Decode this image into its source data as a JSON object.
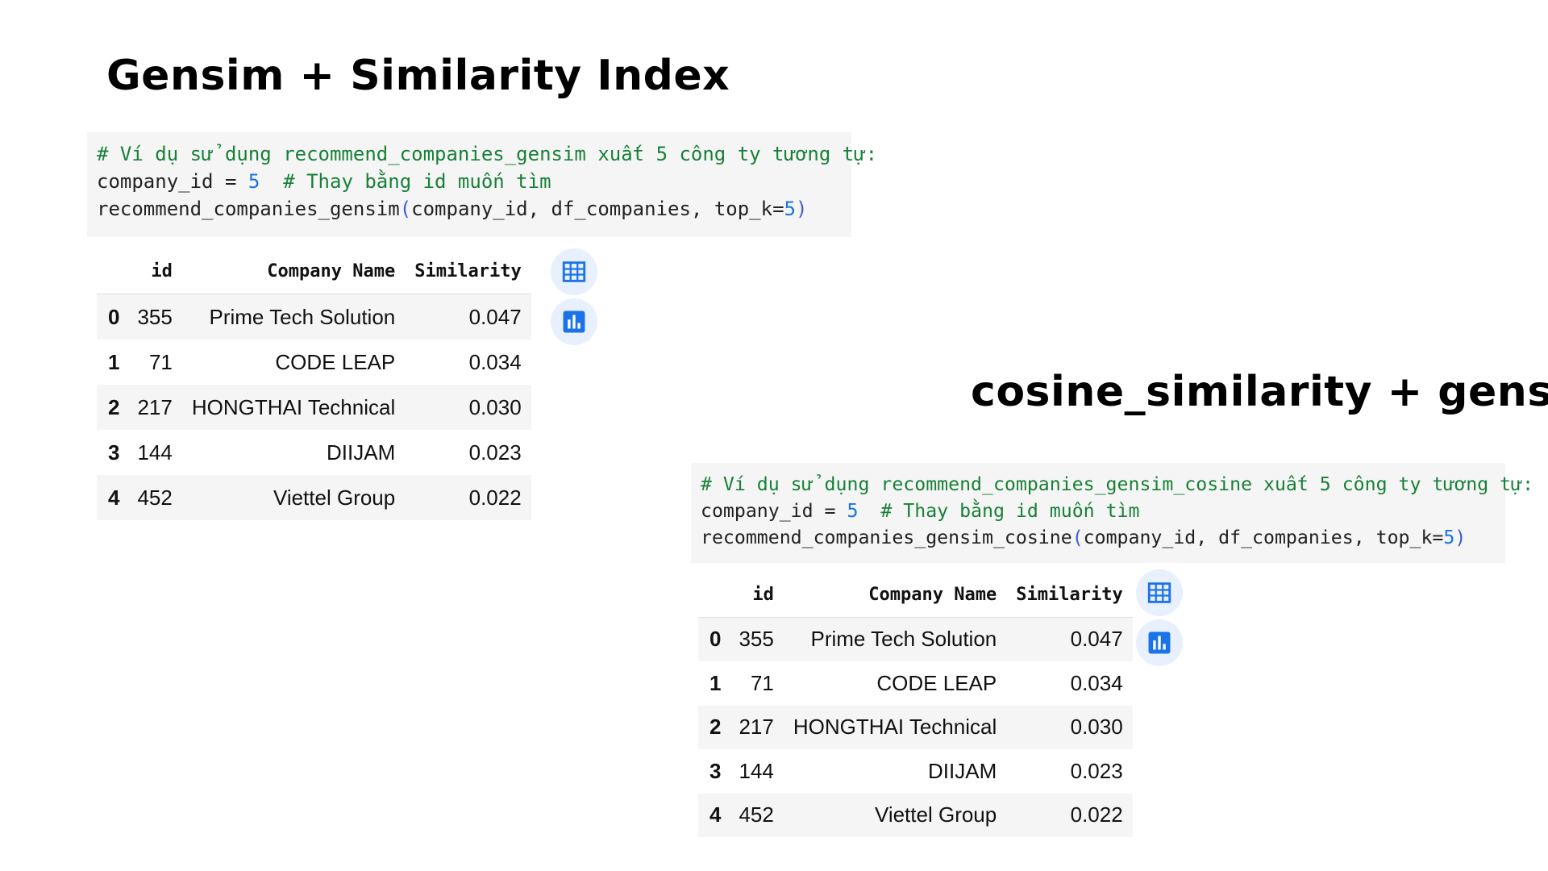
{
  "headings": {
    "left": "Gensim + Similarity Index",
    "right": "cosine_similarity + gensim"
  },
  "code_left": {
    "comment": "# Ví dụ sử dụng recommend_companies_gensim xuất 5 công ty tương tự:",
    "line2_prefix": "company_id = ",
    "line2_num": "5",
    "line2_comment": "  # Thay bằng id muốn tìm",
    "line3_func": "recommend_companies_gensim",
    "line3_open": "(",
    "line3_args": "company_id, df_companies, top_k=",
    "line3_num": "5",
    "line3_close": ")"
  },
  "code_right": {
    "comment": "# Ví dụ sử dụng recommend_companies_gensim_cosine xuất 5 công ty tương tự:",
    "line2_prefix": "company_id = ",
    "line2_num": "5",
    "line2_comment": "  # Thay bằng id muốn tìm",
    "line3_func": "recommend_companies_gensim_cosine",
    "line3_open": "(",
    "line3_args": "company_id, df_companies, top_k=",
    "line3_num": "5",
    "line3_close": ")"
  },
  "table_columns": [
    "",
    "id",
    "Company Name",
    "Similarity"
  ],
  "table_rows": [
    {
      "index": "0",
      "id": "355",
      "name": "Prime Tech Solution",
      "similarity": "0.047"
    },
    {
      "index": "1",
      "id": "71",
      "name": "CODE LEAP",
      "similarity": "0.034"
    },
    {
      "index": "2",
      "id": "217",
      "name": "HONGTHAI Technical",
      "similarity": "0.030"
    },
    {
      "index": "3",
      "id": "144",
      "name": "DIIJAM",
      "similarity": "0.023"
    },
    {
      "index": "4",
      "id": "452",
      "name": "Viettel Group",
      "similarity": "0.022"
    }
  ],
  "icons": {
    "table_button": "table-icon",
    "chart_button": "bar-chart-icon",
    "accent": "#1a73e8",
    "button_bg": "#e8f0fe"
  }
}
